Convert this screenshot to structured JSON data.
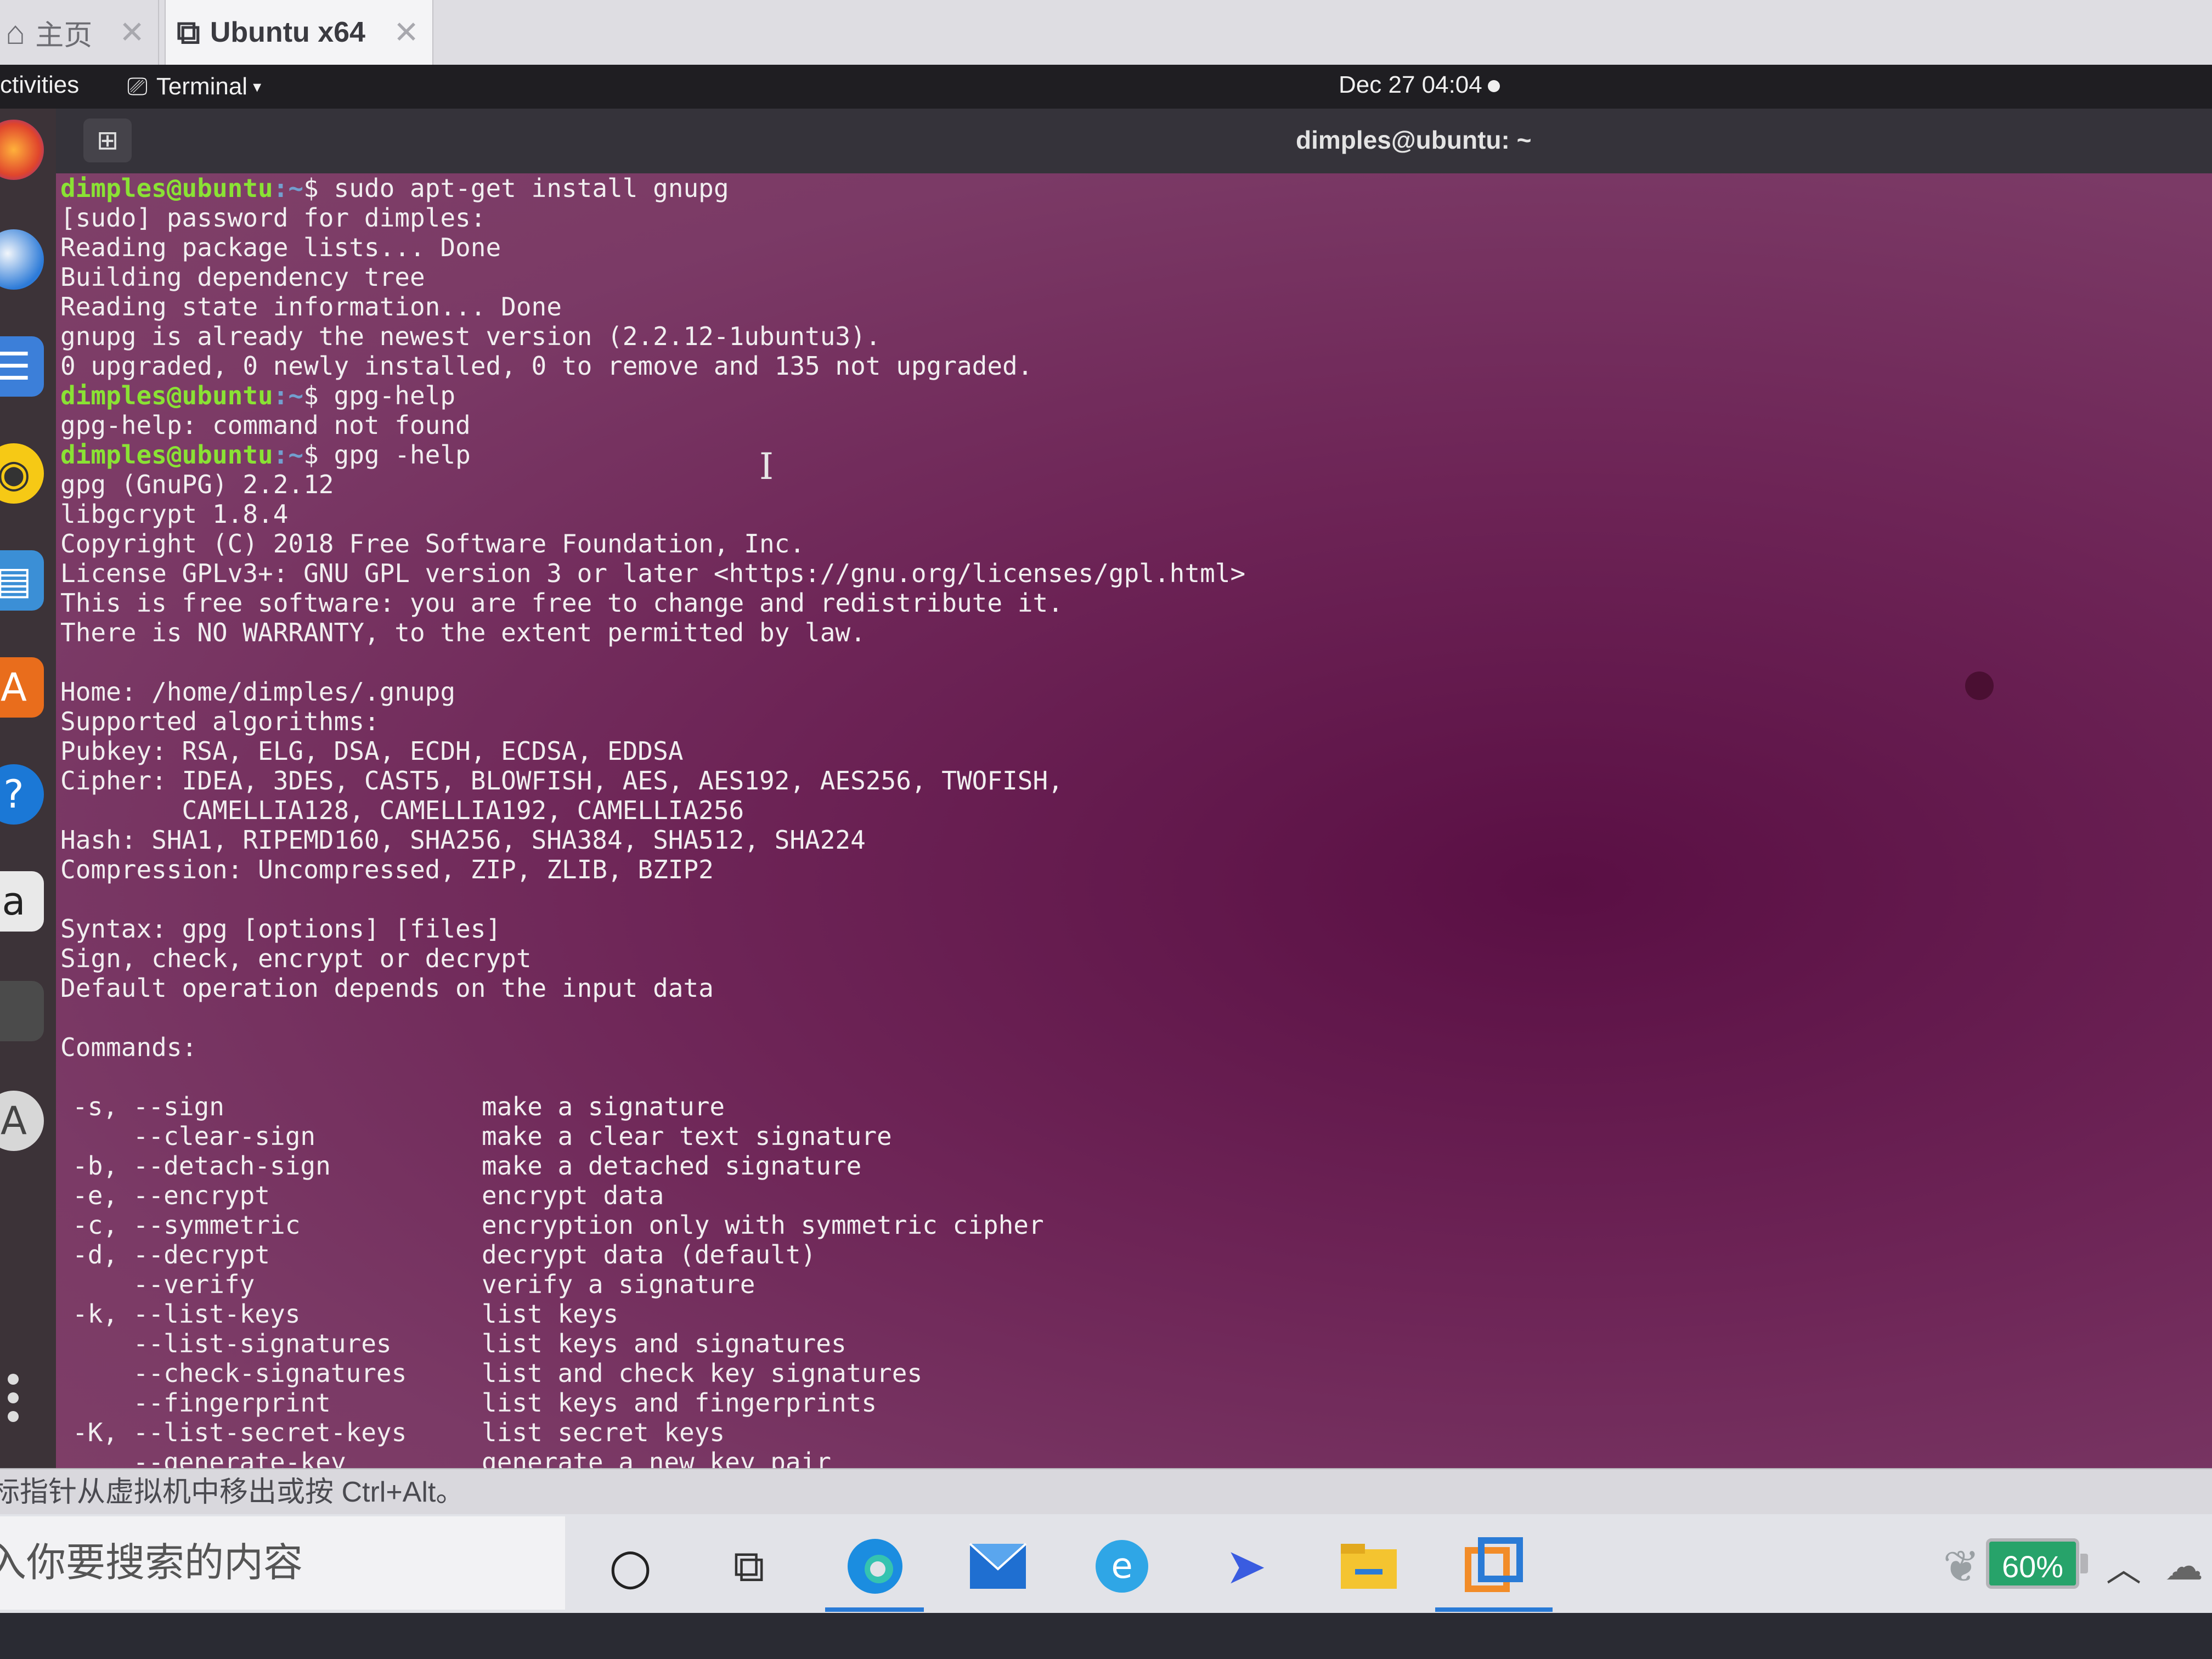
{
  "vm_tabs": {
    "home_label": "主页",
    "active_label": "Ubuntu x64",
    "close_glyph": "✕"
  },
  "topbar": {
    "activities": "ctivities",
    "app_menu": "Terminal",
    "caret": "▾",
    "clock": "Dec 27  04:04"
  },
  "terminal": {
    "title": "dimples@ubuntu: ~",
    "new_tab_glyph": "⊞",
    "prompt_user": "dimples@ubuntu",
    "prompt_path": ":~",
    "prompt_symbol": "$ ",
    "cmd1": "sudo apt-get install gnupg",
    "cmd2": "gpg-help",
    "cmd3": "gpg -help",
    "out1": [
      "[sudo] password for dimples:",
      "Reading package lists... Done",
      "Building dependency tree",
      "Reading state information... Done",
      "gnupg is already the newest version (2.2.12-1ubuntu3).",
      "0 upgraded, 0 newly installed, 0 to remove and 135 not upgraded."
    ],
    "out2": "gpg-help: command not found",
    "out3": [
      "gpg (GnuPG) 2.2.12",
      "libgcrypt 1.8.4",
      "Copyright (C) 2018 Free Software Foundation, Inc.",
      "License GPLv3+: GNU GPL version 3 or later <https://gnu.org/licenses/gpl.html>",
      "This is free software: you are free to change and redistribute it.",
      "There is NO WARRANTY, to the extent permitted by law.",
      "",
      "Home: /home/dimples/.gnupg",
      "Supported algorithms:",
      "Pubkey: RSA, ELG, DSA, ECDH, ECDSA, EDDSA",
      "Cipher: IDEA, 3DES, CAST5, BLOWFISH, AES, AES192, AES256, TWOFISH,",
      "        CAMELLIA128, CAMELLIA192, CAMELLIA256",
      "Hash: SHA1, RIPEMD160, SHA256, SHA384, SHA512, SHA224",
      "Compression: Uncompressed, ZIP, ZLIB, BZIP2",
      "",
      "Syntax: gpg [options] [files]",
      "Sign, check, encrypt or decrypt",
      "Default operation depends on the input data",
      "",
      "Commands:"
    ],
    "commands": [
      {
        "opt": "-s, --sign",
        "desc": "make a signature"
      },
      {
        "opt": "    --clear-sign",
        "desc": "make a clear text signature"
      },
      {
        "opt": "-b, --detach-sign",
        "desc": "make a detached signature"
      },
      {
        "opt": "-e, --encrypt",
        "desc": "encrypt data"
      },
      {
        "opt": "-c, --symmetric",
        "desc": "encryption only with symmetric cipher"
      },
      {
        "opt": "-d, --decrypt",
        "desc": "decrypt data (default)"
      },
      {
        "opt": "    --verify",
        "desc": "verify a signature"
      },
      {
        "opt": "-k, --list-keys",
        "desc": "list keys"
      },
      {
        "opt": "    --list-signatures",
        "desc": "list keys and signatures"
      },
      {
        "opt": "    --check-signatures",
        "desc": "list and check key signatures"
      },
      {
        "opt": "    --fingerprint",
        "desc": "list keys and fingerprints"
      },
      {
        "opt": "-K, --list-secret-keys",
        "desc": "list secret keys"
      },
      {
        "opt": "    --generate-key",
        "desc": "generate a new key pair"
      }
    ]
  },
  "dock": {
    "icons": [
      "firefox-icon",
      "thunderbird-icon",
      "files-icon",
      "rhythmbox-icon",
      "writer-icon",
      "software-icon",
      "help-icon",
      "amazon-icon",
      "terminal-icon",
      "updater-icon"
    ]
  },
  "vmware_hint": "标指针从虚拟机中移出或按 Ctrl+Alt。",
  "taskbar": {
    "search_placeholder": "入你要搜索的内容",
    "battery": "60%",
    "up_arrow": "︿"
  },
  "colors": {
    "prompt_user": "#8ae234",
    "prompt_path": "#729fcf",
    "terminal_bg": "#6d2456",
    "battery": "#27a36a"
  }
}
